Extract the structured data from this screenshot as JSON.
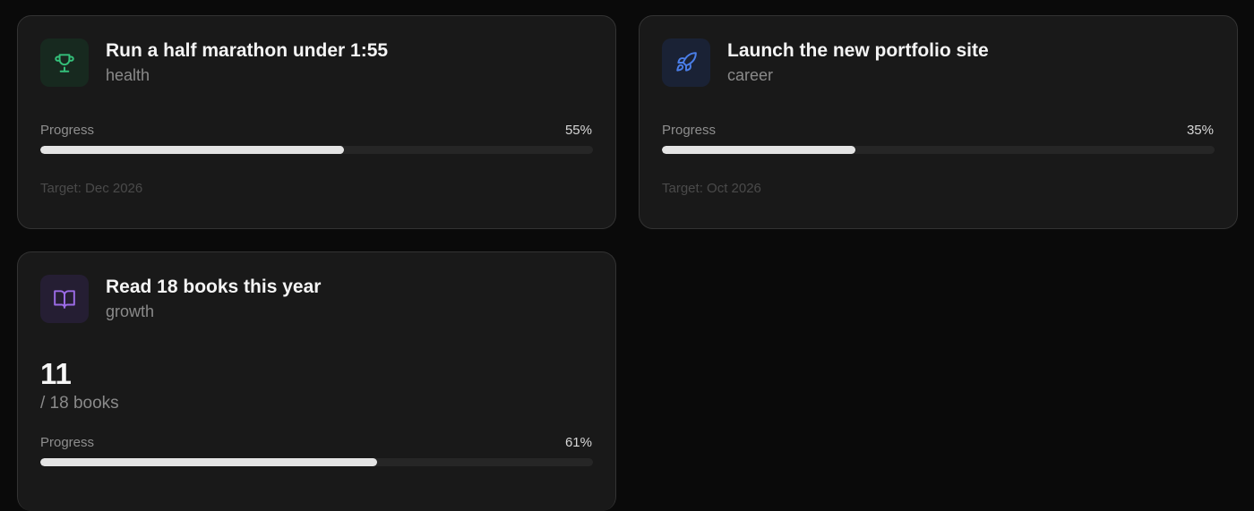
{
  "goals": [
    {
      "title": "Run a half marathon under 1:55",
      "category": "health",
      "icon": "trophy-icon",
      "icon_color": "#34c07a",
      "icon_bg": "#17291f",
      "progress_label": "Progress",
      "progress_percent_text": "55%",
      "progress_fraction": 0.55,
      "target": "Target: Dec 2026"
    },
    {
      "title": "Launch the new portfolio site",
      "category": "career",
      "icon": "rocket-icon",
      "icon_color": "#4a7ee8",
      "icon_bg": "#1a2235",
      "progress_label": "Progress",
      "progress_percent_text": "35%",
      "progress_fraction": 0.35,
      "target": "Target: Oct 2026"
    },
    {
      "title": "Read 18 books this year",
      "category": "growth",
      "icon": "book-open-icon",
      "icon_color": "#9b6be6",
      "icon_bg": "#251e33",
      "count": "11",
      "count_sub": "/ 18 books",
      "progress_label": "Progress",
      "progress_percent_text": "61%",
      "progress_fraction": 0.61
    }
  ]
}
